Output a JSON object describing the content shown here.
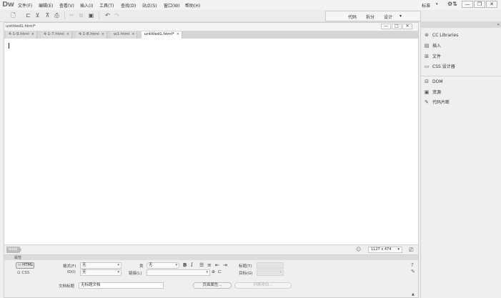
{
  "app": {
    "logo": "Dw",
    "menu": [
      "文件(F)",
      "编辑(E)",
      "查看(V)",
      "插入(I)",
      "工具(T)",
      "查找(D)",
      "站点(S)",
      "窗口(W)",
      "帮助(H)"
    ],
    "workspace": "标准",
    "sync_icon": "sync-settings-icon",
    "window_buttons": [
      "—",
      "❐",
      "✕"
    ]
  },
  "toolbar": {
    "icons": [
      "new-file-icon",
      "open-folder-icon",
      "get-icon",
      "put-icon",
      "print-icon",
      "cut-icon",
      "copy-icon",
      "paste-icon",
      "undo-icon",
      "redo-icon"
    ],
    "views": [
      "代码",
      "拆分",
      "设计"
    ],
    "view_caret": "▾"
  },
  "document": {
    "title": "untitled1.html*",
    "window_buttons": [
      "—",
      "□",
      "✕"
    ],
    "tabs": [
      {
        "label": "4-1-9.html",
        "active": false
      },
      {
        "label": "4-1-7.html",
        "active": false
      },
      {
        "label": "4-1-8.html",
        "active": false
      },
      {
        "label": "w1.html",
        "active": false
      },
      {
        "label": "untitled1.html*",
        "active": true
      }
    ],
    "tab_close": "×",
    "status": {
      "tag": "body",
      "size": "1127 x 474",
      "size_caret": "▾"
    }
  },
  "properties": {
    "title": "属性",
    "html_label": "HTML",
    "css_label": "CSS",
    "format_label": "格式(F)",
    "format_value": "无",
    "id_label": "ID(I)",
    "id_value": "无",
    "class_label": "类",
    "class_value": "无",
    "link_label": "链接(L)",
    "link_value": "",
    "title_label": "标题(T)",
    "target_label": "目标(G)",
    "doc_title_label": "文档标题",
    "doc_title_value": "无标题文档",
    "page_props_button": "页面属性...",
    "list_item_button": "列表项目...",
    "caret": "▾"
  },
  "panels": {
    "group1": [
      {
        "label": "CC Libraries",
        "icon": "cc-libraries-icon",
        "glyph": "⊛"
      },
      {
        "label": "插入",
        "icon": "insert-icon",
        "glyph": "▤"
      },
      {
        "label": "文件",
        "icon": "files-icon",
        "glyph": "⊞"
      },
      {
        "label": "CSS 设计器",
        "icon": "css-designer-icon",
        "glyph": "▭"
      }
    ],
    "group2": [
      {
        "label": "DOM",
        "icon": "dom-icon",
        "glyph": "⊟"
      },
      {
        "label": "资源",
        "icon": "assets-icon",
        "glyph": "▣"
      },
      {
        "label": "代码片断",
        "icon": "snippets-icon",
        "glyph": "✎"
      }
    ]
  }
}
